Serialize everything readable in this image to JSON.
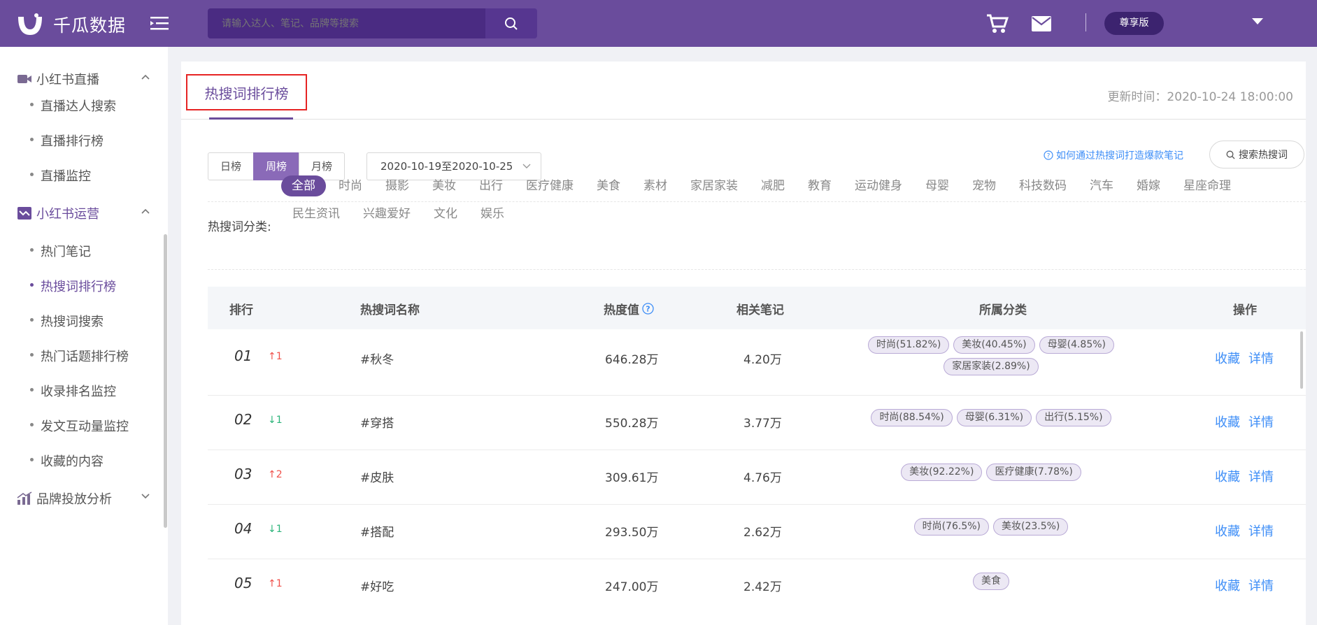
{
  "app": {
    "name": "千瓜数据"
  },
  "header": {
    "search_placeholder": "请输入达人、笔记、品牌等搜索",
    "vip_label": "尊享版"
  },
  "sidebar": {
    "groups": [
      {
        "label": "小红书直播",
        "items": [
          "直播达人搜索",
          "直播排行榜",
          "直播监控"
        ]
      },
      {
        "label": "小红书运营",
        "items": [
          "热门笔记",
          "热搜词排行榜",
          "热搜词搜索",
          "热门话题排行榜",
          "收录排名监控",
          "发文互动量监控",
          "收藏的内容"
        ]
      },
      {
        "label": "品牌投放分析",
        "items": []
      }
    ]
  },
  "page": {
    "title": "热搜词排行榜",
    "update_time": "更新时间：2020-10-24 18:00:00",
    "periods": [
      "日榜",
      "周榜",
      "月榜"
    ],
    "active_period": "周榜",
    "date_range": "2020-10-19至2020-10-25",
    "help_link": "如何通过热搜词打造爆款笔记",
    "search_hot_label": "搜索热搜词",
    "category_label": "热搜词分类:",
    "categories": [
      "全部",
      "时尚",
      "摄影",
      "美妆",
      "出行",
      "医疗健康",
      "美食",
      "素材",
      "家居家装",
      "减肥",
      "教育",
      "运动健身",
      "母婴",
      "宠物",
      "科技数码",
      "汽车",
      "婚嫁",
      "星座命理",
      "民生资讯",
      "兴趣爱好",
      "文化",
      "娱乐"
    ]
  },
  "table": {
    "headers": {
      "rank": "排行",
      "keyword": "热搜词名称",
      "heat": "热度值",
      "notes": "相关笔记",
      "category": "所属分类",
      "action": "操作"
    },
    "actions": {
      "favorite": "收藏",
      "detail": "详情"
    },
    "rows": [
      {
        "rank": "01",
        "trend": "↑1",
        "dir": "up",
        "keyword": "#秋冬",
        "heat": "646.28万",
        "notes": "4.20万",
        "tags": [
          "时尚(51.82%)",
          "美妆(40.45%)",
          "母婴(4.85%)",
          "家居家装(2.89%)"
        ]
      },
      {
        "rank": "02",
        "trend": "↓1",
        "dir": "down",
        "keyword": "#穿搭",
        "heat": "550.28万",
        "notes": "3.77万",
        "tags": [
          "时尚(88.54%)",
          "母婴(6.31%)",
          "出行(5.15%)"
        ]
      },
      {
        "rank": "03",
        "trend": "↑2",
        "dir": "up",
        "keyword": "#皮肤",
        "heat": "309.61万",
        "notes": "4.76万",
        "tags": [
          "美妆(92.22%)",
          "医疗健康(7.78%)"
        ]
      },
      {
        "rank": "04",
        "trend": "↓1",
        "dir": "down",
        "keyword": "#搭配",
        "heat": "293.50万",
        "notes": "2.62万",
        "tags": [
          "时尚(76.5%)",
          "美妆(23.5%)"
        ]
      },
      {
        "rank": "05",
        "trend": "↑1",
        "dir": "up",
        "keyword": "#好吃",
        "heat": "247.00万",
        "notes": "2.42万",
        "tags": [
          "美食"
        ]
      }
    ]
  },
  "colors": {
    "brand": "#6a4c9c",
    "link": "#3e8ef7",
    "up": "#f0504a",
    "down": "#2cb47a"
  }
}
